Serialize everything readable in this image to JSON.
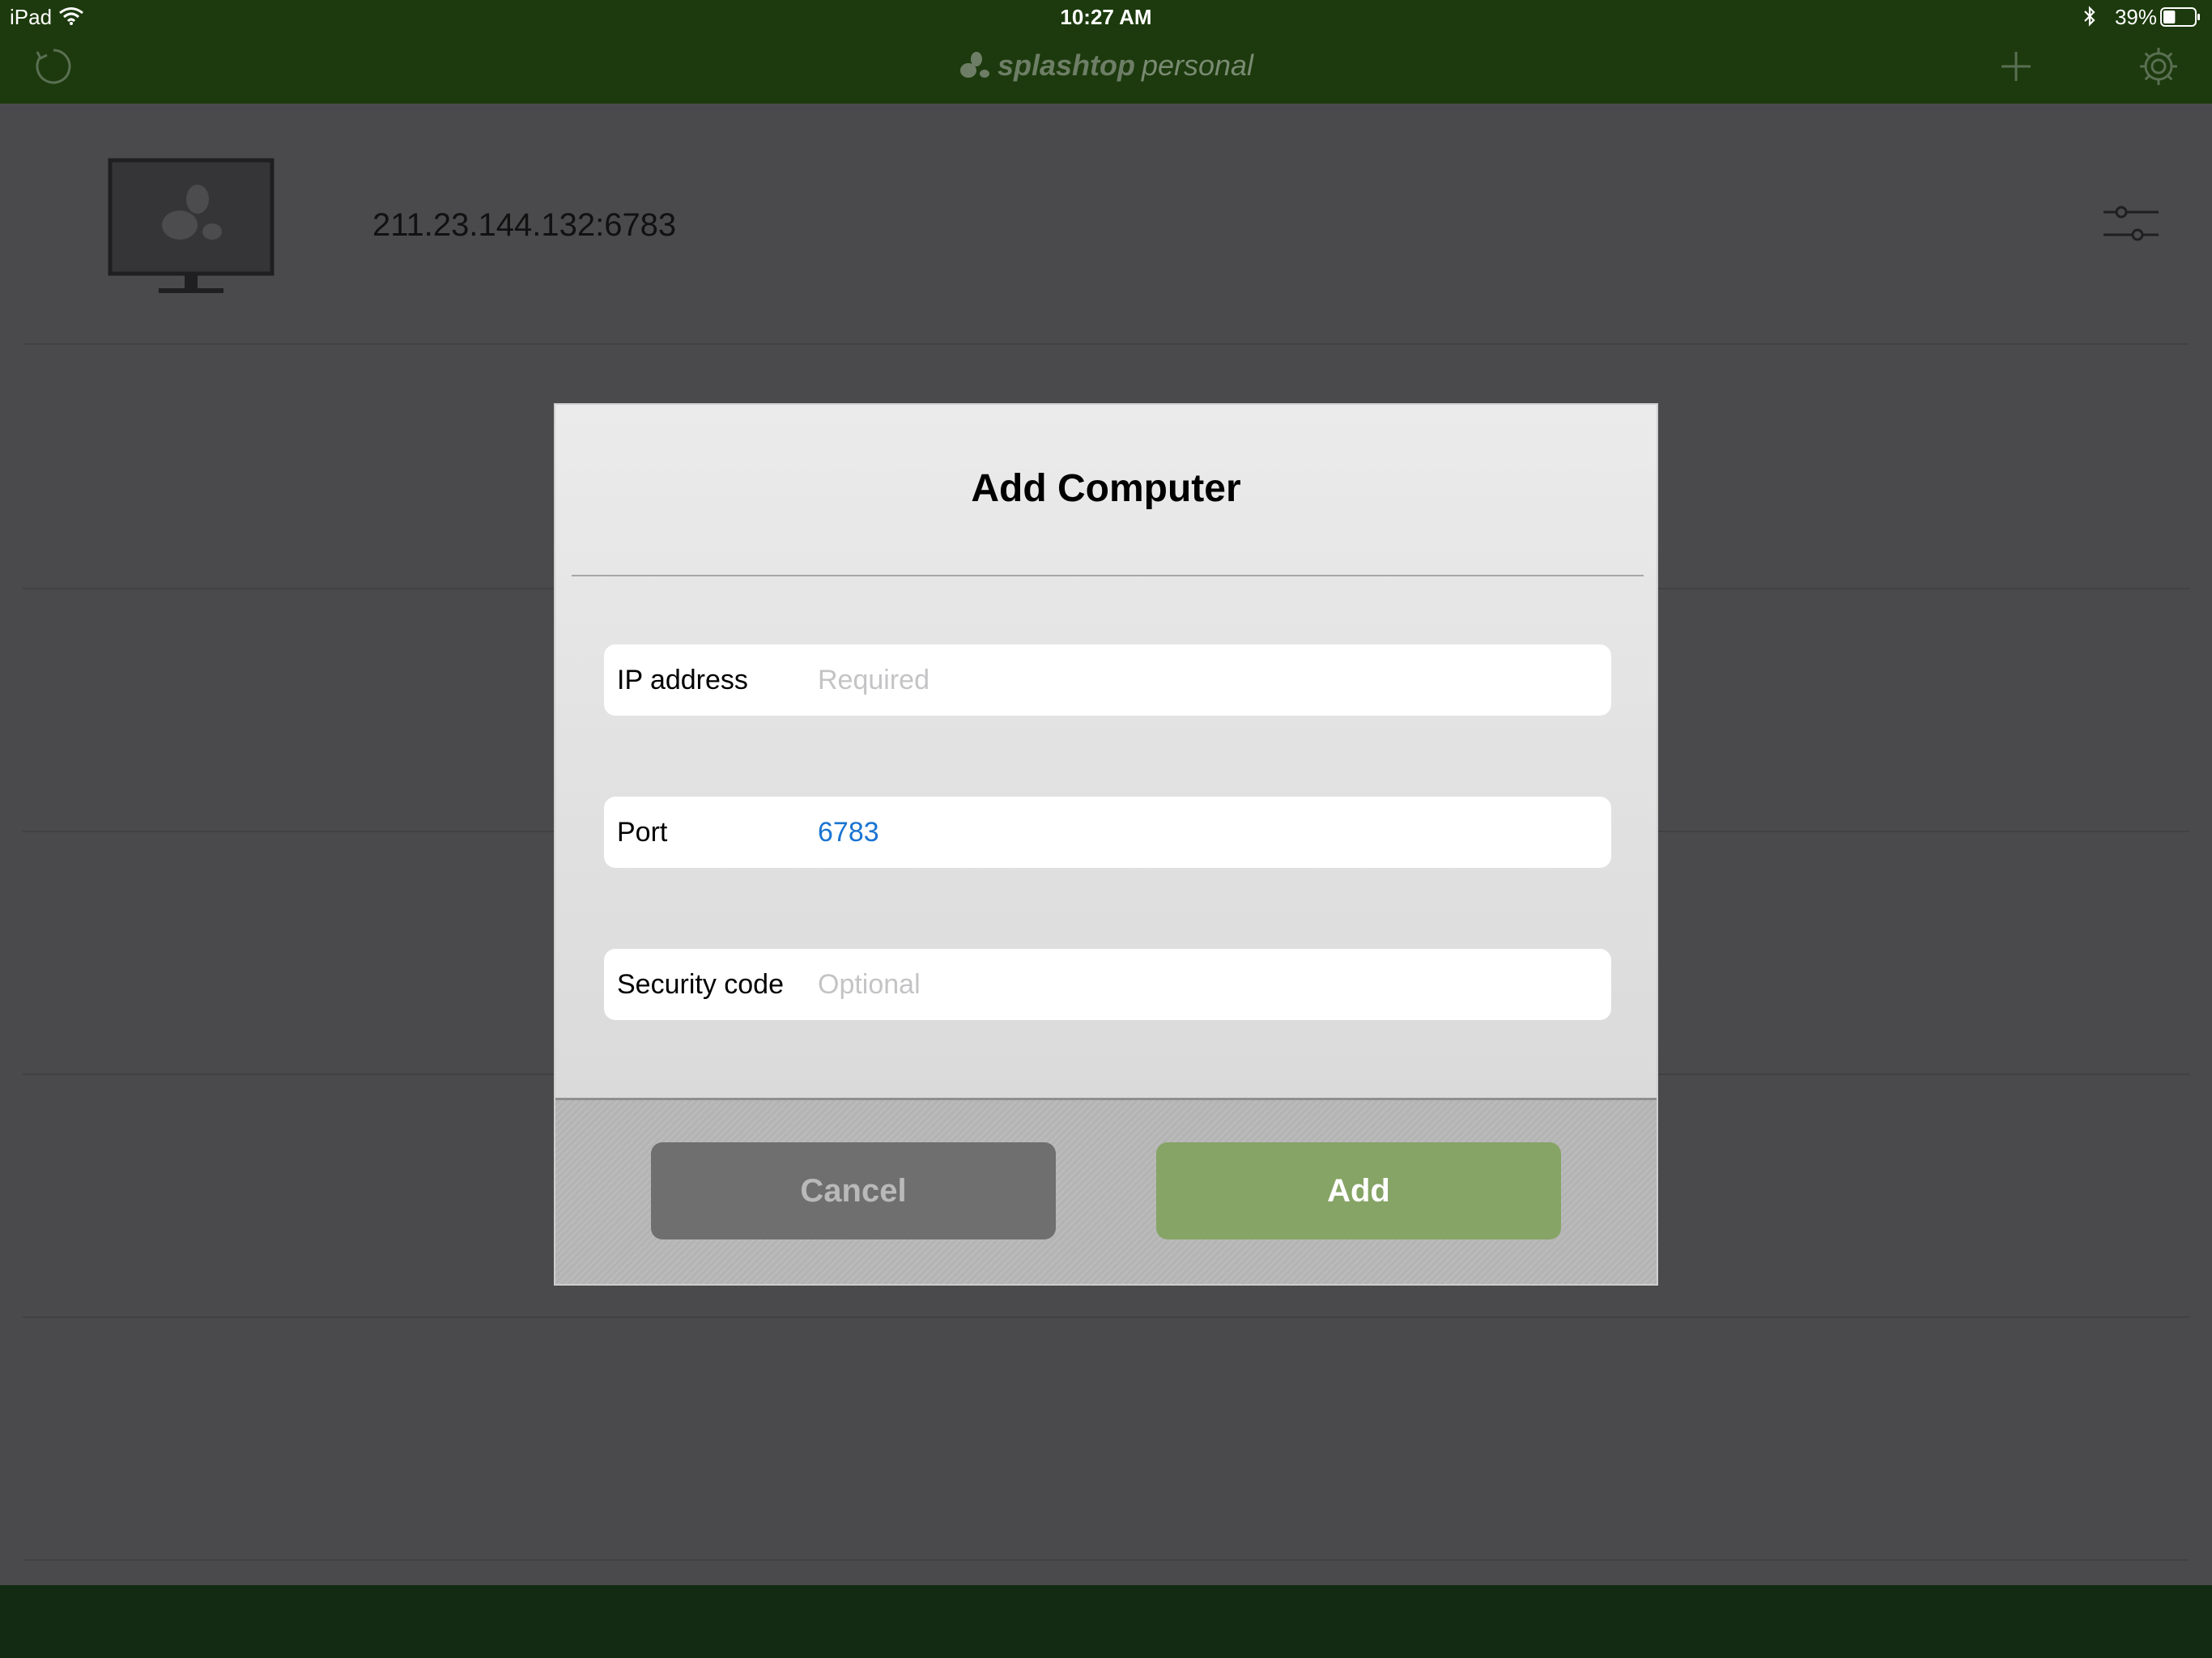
{
  "status_bar": {
    "carrier": "iPad",
    "time": "10:27 AM",
    "battery_percent": "39%",
    "battery_level": 0.39,
    "icons": [
      "wifi-icon",
      "bluetooth-icon",
      "battery-icon"
    ]
  },
  "nav_bar": {
    "brand_name": "splashtop",
    "brand_edition": "personal",
    "icons": [
      "refresh-icon",
      "splashtop-logo-icon",
      "add-icon",
      "gear-icon"
    ]
  },
  "computer_list": {
    "items": [
      {
        "address": "211.23.144.132:6783",
        "icons": [
          "computer-monitor-icon",
          "row-settings-sliders-icon"
        ]
      }
    ]
  },
  "dialog": {
    "title": "Add Computer",
    "fields": [
      {
        "label": "IP address",
        "value": "",
        "placeholder": "Required"
      },
      {
        "label": "Port",
        "value": "6783",
        "placeholder": ""
      },
      {
        "label": "Security code",
        "value": "",
        "placeholder": "Optional"
      }
    ],
    "cancel_label": "Cancel",
    "add_label": "Add"
  },
  "colors": {
    "nav_green": "#1c3a0d",
    "bottom_bar_green": "#132b13",
    "add_button_green": "#86a465",
    "cancel_button_gray": "#6f6f6f",
    "port_value_blue": "#1a74d1"
  }
}
